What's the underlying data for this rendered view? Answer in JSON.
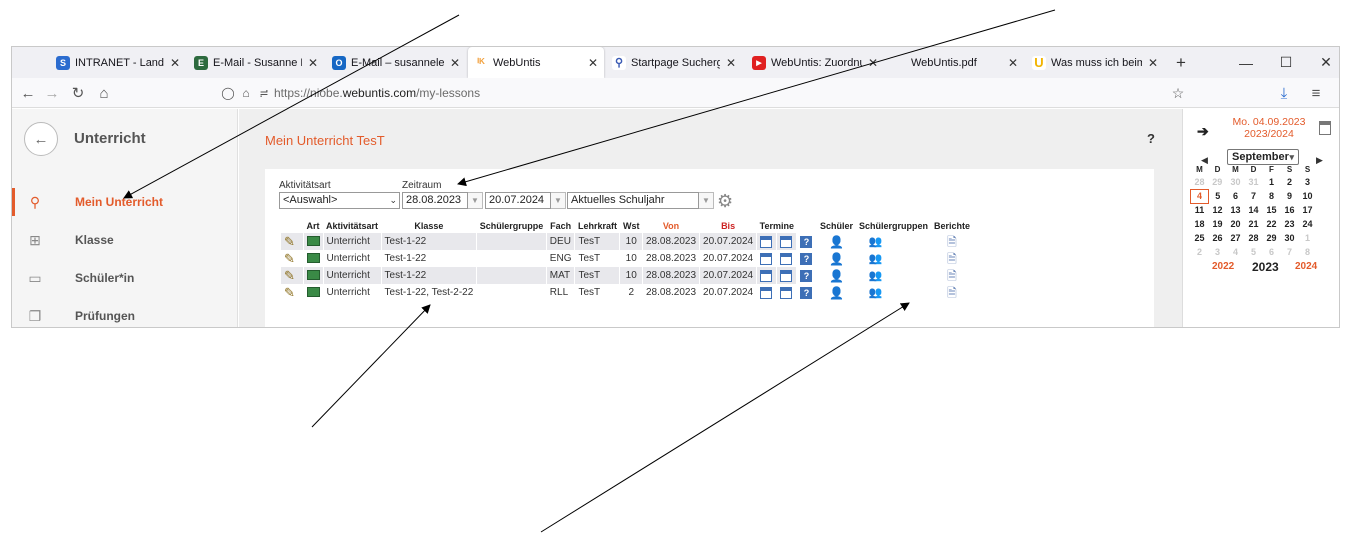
{
  "browser": {
    "tabs": [
      {
        "favicon_icon": "intranet-favicon-icon",
        "favicon_color": "#2b6ccf",
        "favicon_text": "S",
        "title": "INTRANET - Landesne"
      },
      {
        "favicon_icon": "email-favicon-icon",
        "favicon_color": "#2d6a3e",
        "favicon_text": "E",
        "title": "E-Mail - Susanne Levs"
      },
      {
        "favicon_icon": "outlook-favicon-icon",
        "favicon_color": "#1667c4",
        "favicon_text": "O",
        "title": "E-Mail – susannelevse"
      },
      {
        "favicon_icon": "webuntis-favicon-icon",
        "favicon_color": "#f2a03b",
        "favicon_text": "▪",
        "title": "WebUntis"
      },
      {
        "favicon_icon": "search-favicon-icon",
        "favicon_color": "#ffffff",
        "favicon_text": "🔍",
        "title": "Startpage Suchergebn"
      },
      {
        "favicon_icon": "youtube-favicon-icon",
        "favicon_color": "#e02020",
        "favicon_text": "▶",
        "title": "WebUntis: Zuordnun"
      },
      {
        "favicon_icon": "pdf-favicon-icon",
        "favicon_color": "#ffffff",
        "favicon_text": "",
        "title": "WebUntis.pdf"
      },
      {
        "favicon_icon": "u-favicon-icon",
        "favicon_color": "#ffffff",
        "favicon_text": "U",
        "title": "Was muss ich beim E"
      }
    ],
    "url_prefix": "https://niobe.",
    "url_domain": "webuntis.com",
    "url_path": "/my-lessons"
  },
  "sidebar": {
    "title": "Unterricht",
    "items": [
      {
        "label": "Mein Unterricht",
        "icon": "my-lessons-icon",
        "active": true
      },
      {
        "label": "Klasse",
        "icon": "class-icon",
        "active": false
      },
      {
        "label": "Schüler*in",
        "icon": "student-icon",
        "active": false
      },
      {
        "label": "Prüfungen",
        "icon": "exams-icon",
        "active": false
      }
    ]
  },
  "main": {
    "title": "Mein Unterricht TesT",
    "help": "?",
    "filters": {
      "activity_label": "Aktivitätsart",
      "activity_value": "<Auswahl>",
      "period_label": "Zeitraum",
      "from_date": "28.08.2023",
      "to_date": "20.07.2024",
      "period_value": "Aktuelles Schuljahr"
    },
    "columns": [
      "Art",
      "Aktivitätsart",
      "Klasse",
      "Schülergruppe",
      "Fach",
      "Lehrkraft",
      "Wst",
      "Von",
      "Bis",
      "Termine",
      "Schüler",
      "Schülergruppen",
      "Berichte"
    ],
    "rows": [
      {
        "activity": "Unterricht",
        "klasse": "Test-1-22",
        "group": "",
        "fach": "DEU",
        "lehrkraft": "TesT",
        "wst": "10",
        "von": "28.08.2023",
        "bis": "20.07.2024"
      },
      {
        "activity": "Unterricht",
        "klasse": "Test-1-22",
        "group": "",
        "fach": "ENG",
        "lehrkraft": "TesT",
        "wst": "10",
        "von": "28.08.2023",
        "bis": "20.07.2024"
      },
      {
        "activity": "Unterricht",
        "klasse": "Test-1-22",
        "group": "",
        "fach": "MAT",
        "lehrkraft": "TesT",
        "wst": "10",
        "von": "28.08.2023",
        "bis": "20.07.2024"
      },
      {
        "activity": "Unterricht",
        "klasse": "Test-1-22, Test-2-22",
        "group": "",
        "fach": "RLL",
        "lehrkraft": "TesT",
        "wst": "2",
        "von": "28.08.2023",
        "bis": "20.07.2024"
      }
    ]
  },
  "right_panel": {
    "date_line1": "Mo. 04.09.2023",
    "date_line2": "2023/2024",
    "month": "September",
    "weekdays": [
      "M",
      "D",
      "M",
      "D",
      "F",
      "S",
      "S"
    ],
    "weeks": [
      [
        "28",
        "29",
        "30",
        "31",
        "1",
        "2",
        "3"
      ],
      [
        "4",
        "5",
        "6",
        "7",
        "8",
        "9",
        "10"
      ],
      [
        "11",
        "12",
        "13",
        "14",
        "15",
        "16",
        "17"
      ],
      [
        "18",
        "19",
        "20",
        "21",
        "22",
        "23",
        "24"
      ],
      [
        "25",
        "26",
        "27",
        "28",
        "29",
        "30",
        "1"
      ],
      [
        "2",
        "3",
        "4",
        "5",
        "6",
        "7",
        "8"
      ]
    ],
    "year_prev": "2022",
    "year_current": "2023",
    "year_next": "2024"
  },
  "colors": {
    "accent": "#e35b2b",
    "active_tab_favicon": "#f2a03b"
  }
}
